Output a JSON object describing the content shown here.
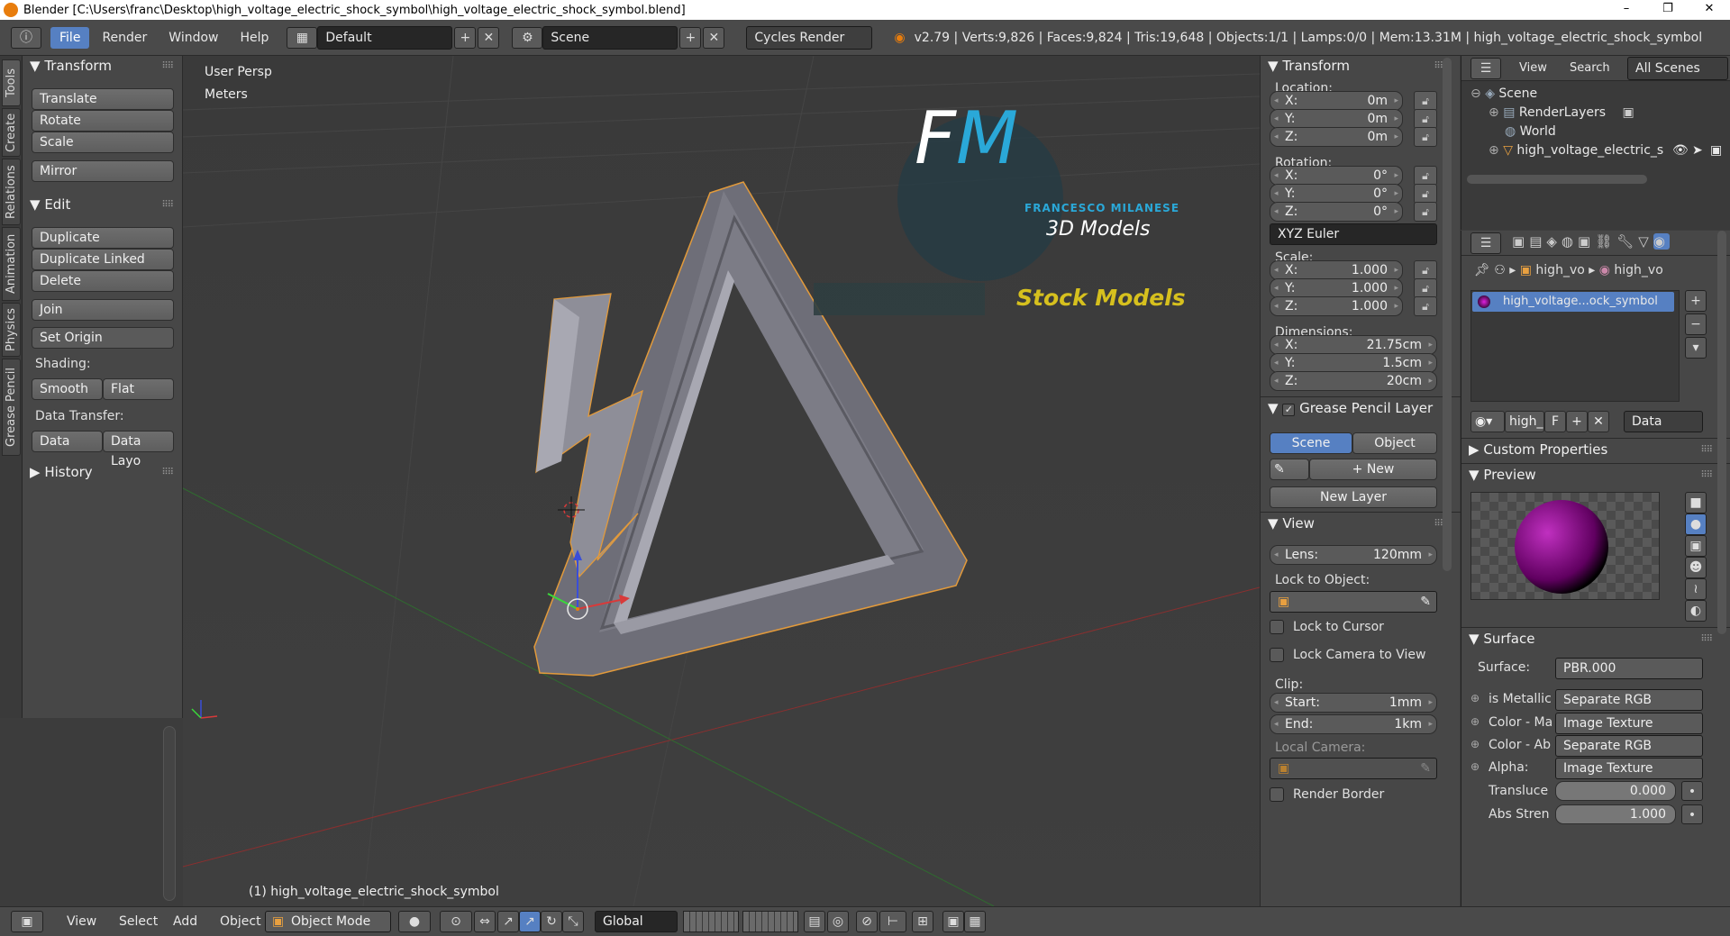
{
  "window": {
    "title": "Blender [C:\\Users\\franc\\Desktop\\high_voltage_electric_shock_symbol\\high_voltage_electric_shock_symbol.blend]",
    "minimize": "–",
    "maximize": "❐",
    "close": "✕"
  },
  "info": {
    "menus": [
      "File",
      "Render",
      "Window",
      "Help"
    ],
    "layout": "Default",
    "scene": "Scene",
    "engine": "Cycles Render",
    "stats": "v2.79 | Verts:9,826 | Faces:9,824 | Tris:19,648 | Objects:1/1 | Lamps:0/0 | Mem:13.31M | high_voltage_electric_shock_symbol"
  },
  "tabs": [
    "Tools",
    "Create",
    "Relations",
    "Animation",
    "Physics",
    "Grease Pencil"
  ],
  "toolshelf": {
    "transform_title": "Transform",
    "translate": "Translate",
    "rotate": "Rotate",
    "scale": "Scale",
    "mirror": "Mirror",
    "edit_title": "Edit",
    "duplicate": "Duplicate",
    "duplicate_linked": "Duplicate Linked",
    "delete": "Delete",
    "join": "Join",
    "set_origin": "Set Origin",
    "shading": "Shading:",
    "smooth": "Smooth",
    "flat": "Flat",
    "data_transfer": "Data Transfer:",
    "data": "Data",
    "data_layo": "Data Layo",
    "history": "History"
  },
  "viewport": {
    "view_name": "User Persp",
    "units": "Meters",
    "object_label": "(1) high_voltage_electric_shock_symbol",
    "logo_fm": "FM",
    "logo_name": "FRANCESCO MILANESE",
    "logo_sub": "3D Models",
    "logo_stock": "Stock Models"
  },
  "npanel": {
    "transform": "Transform",
    "location": "Location:",
    "loc": [
      "0m",
      "0m",
      "0m"
    ],
    "rotation": "Rotation:",
    "rot": [
      "0°",
      "0°",
      "0°"
    ],
    "euler": "XYZ Euler",
    "scale": "Scale:",
    "scl": [
      "1.000",
      "1.000",
      "1.000"
    ],
    "dimensions": "Dimensions:",
    "dim": [
      "21.75cm",
      "1.5cm",
      "20cm"
    ],
    "axes": [
      "X:",
      "Y:",
      "Z:"
    ],
    "gp_layer": "Grease Pencil Layer",
    "scene_btn": "Scene",
    "object_btn": "Object",
    "new": "New",
    "new_layer": "New Layer",
    "view": "View",
    "lens_k": "Lens:",
    "lens_v": "120mm",
    "lock_obj": "Lock to Object:",
    "lock_cursor": "Lock to Cursor",
    "lock_camera": "Lock Camera to View",
    "clip": "Clip:",
    "start_k": "Start:",
    "start_v": "1mm",
    "end_k": "End:",
    "end_v": "1km",
    "local_camera": "Local Camera:",
    "render_border": "Render Border"
  },
  "outliner": {
    "view": "View",
    "search": "Search",
    "all_scenes": "All Scenes",
    "scene": "Scene",
    "renderlayers": "RenderLayers",
    "world": "World",
    "object": "high_voltage_electric_s"
  },
  "props": {
    "crumb1": "high_vo",
    "crumb2": "high_vo",
    "material": "high_voltage...ock_symbol",
    "mat_field": "high_",
    "f": "F",
    "data": "Data",
    "custom": "Custom Properties",
    "preview": "Preview",
    "surface": "Surface",
    "surface_k": "Surface:",
    "surface_v": "PBR.000",
    "rows": [
      {
        "k": "is Metallic",
        "v": "Separate RGB"
      },
      {
        "k": "Color - Ma",
        "v": "Image Texture"
      },
      {
        "k": "Color - Ab",
        "v": "Separate RGB"
      },
      {
        "k": "Alpha:",
        "v": "Image Texture"
      }
    ],
    "transluce_k": "Transluce",
    "transluce_v": "0.000",
    "abs_k": "Abs Stren",
    "abs_v": "1.000"
  },
  "bottom": {
    "view": "View",
    "select": "Select",
    "add": "Add",
    "object": "Object",
    "mode": "Object Mode",
    "orientation": "Global"
  }
}
